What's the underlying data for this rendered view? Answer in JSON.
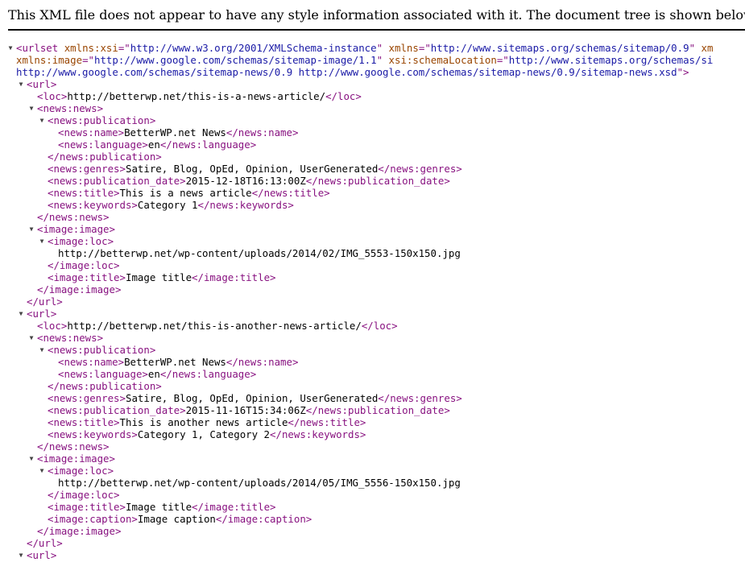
{
  "banner": {
    "message": "This XML file does not appear to have any style information associated with it. The document tree is shown below."
  },
  "colors": {
    "tag": "#881280",
    "attribute_name": "#994500",
    "attribute_value": "#1a1aa6",
    "text": "#000000"
  },
  "icons": {
    "collapse": "down-triangle-icon"
  },
  "lines": [
    [
      [
        "t",
        "<urlset"
      ],
      [
        "s",
        " "
      ],
      [
        "a",
        "xmlns:xsi"
      ],
      [
        "t",
        "=\""
      ],
      [
        "v",
        "http://www.w3.org/2001/XMLSchema-instance"
      ],
      [
        "t",
        "\""
      ],
      [
        "s",
        " "
      ],
      [
        "a",
        "xmlns"
      ],
      [
        "t",
        "=\""
      ],
      [
        "v",
        "http://www.sitemaps.org/schemas/sitemap/0.9"
      ],
      [
        "t",
        "\""
      ],
      [
        "s",
        " "
      ],
      [
        "a",
        "xm"
      ]
    ],
    [
      [
        "a",
        "xmlns:image"
      ],
      [
        "t",
        "=\""
      ],
      [
        "v",
        "http://www.google.com/schemas/sitemap-image/1.1"
      ],
      [
        "t",
        "\""
      ],
      [
        "s",
        " "
      ],
      [
        "a",
        "xsi:schemaLocation"
      ],
      [
        "t",
        "=\""
      ],
      [
        "v",
        "http://www.sitemaps.org/schemas/si"
      ]
    ],
    [
      [
        "v",
        "http://www.google.com/schemas/sitemap-news/0.9 http://www.google.com/schemas/sitemap-news/0.9/sitemap-news.xsd"
      ],
      [
        "t",
        "\">"
      ]
    ],
    [
      [
        "t",
        "<url>"
      ]
    ],
    [
      [
        "t",
        "<loc>"
      ],
      [
        "x",
        "http://betterwp.net/this-is-a-news-article/"
      ],
      [
        "t",
        "</loc>"
      ]
    ],
    [
      [
        "t",
        "<news:news>"
      ]
    ],
    [
      [
        "t",
        "<news:publication>"
      ]
    ],
    [
      [
        "t",
        "<news:name>"
      ],
      [
        "x",
        "BetterWP.net News"
      ],
      [
        "t",
        "</news:name>"
      ]
    ],
    [
      [
        "t",
        "<news:language>"
      ],
      [
        "x",
        "en"
      ],
      [
        "t",
        "</news:language>"
      ]
    ],
    [
      [
        "t",
        "</news:publication>"
      ]
    ],
    [
      [
        "t",
        "<news:genres>"
      ],
      [
        "x",
        "Satire, Blog, OpEd, Opinion, UserGenerated"
      ],
      [
        "t",
        "</news:genres>"
      ]
    ],
    [
      [
        "t",
        "<news:publication_date>"
      ],
      [
        "x",
        "2015-12-18T16:13:00Z"
      ],
      [
        "t",
        "</news:publication_date>"
      ]
    ],
    [
      [
        "t",
        "<news:title>"
      ],
      [
        "x",
        "This is a news article"
      ],
      [
        "t",
        "</news:title>"
      ]
    ],
    [
      [
        "t",
        "<news:keywords>"
      ],
      [
        "x",
        "Category 1"
      ],
      [
        "t",
        "</news:keywords>"
      ]
    ],
    [
      [
        "t",
        "</news:news>"
      ]
    ],
    [
      [
        "t",
        "<image:image>"
      ]
    ],
    [
      [
        "t",
        "<image:loc>"
      ]
    ],
    [
      [
        "x",
        "http://betterwp.net/wp-content/uploads/2014/02/IMG_5553-150x150.jpg"
      ]
    ],
    [
      [
        "t",
        "</image:loc>"
      ]
    ],
    [
      [
        "t",
        "<image:title>"
      ],
      [
        "x",
        "Image title"
      ],
      [
        "t",
        "</image:title>"
      ]
    ],
    [
      [
        "t",
        "</image:image>"
      ]
    ],
    [
      [
        "t",
        "</url>"
      ]
    ],
    [
      [
        "t",
        "<url>"
      ]
    ],
    [
      [
        "t",
        "<loc>"
      ],
      [
        "x",
        "http://betterwp.net/this-is-another-news-article/"
      ],
      [
        "t",
        "</loc>"
      ]
    ],
    [
      [
        "t",
        "<news:news>"
      ]
    ],
    [
      [
        "t",
        "<news:publication>"
      ]
    ],
    [
      [
        "t",
        "<news:name>"
      ],
      [
        "x",
        "BetterWP.net News"
      ],
      [
        "t",
        "</news:name>"
      ]
    ],
    [
      [
        "t",
        "<news:language>"
      ],
      [
        "x",
        "en"
      ],
      [
        "t",
        "</news:language>"
      ]
    ],
    [
      [
        "t",
        "</news:publication>"
      ]
    ],
    [
      [
        "t",
        "<news:genres>"
      ],
      [
        "x",
        "Satire, Blog, OpEd, Opinion, UserGenerated"
      ],
      [
        "t",
        "</news:genres>"
      ]
    ],
    [
      [
        "t",
        "<news:publication_date>"
      ],
      [
        "x",
        "2015-11-16T15:34:06Z"
      ],
      [
        "t",
        "</news:publication_date>"
      ]
    ],
    [
      [
        "t",
        "<news:title>"
      ],
      [
        "x",
        "This is another news article"
      ],
      [
        "t",
        "</news:title>"
      ]
    ],
    [
      [
        "t",
        "<news:keywords>"
      ],
      [
        "x",
        "Category 1, Category 2"
      ],
      [
        "t",
        "</news:keywords>"
      ]
    ],
    [
      [
        "t",
        "</news:news>"
      ]
    ],
    [
      [
        "t",
        "<image:image>"
      ]
    ],
    [
      [
        "t",
        "<image:loc>"
      ]
    ],
    [
      [
        "x",
        "http://betterwp.net/wp-content/uploads/2014/05/IMG_5556-150x150.jpg"
      ]
    ],
    [
      [
        "t",
        "</image:loc>"
      ]
    ],
    [
      [
        "t",
        "<image:title>"
      ],
      [
        "x",
        "Image title"
      ],
      [
        "t",
        "</image:title>"
      ]
    ],
    [
      [
        "t",
        "<image:caption>"
      ],
      [
        "x",
        "Image caption"
      ],
      [
        "t",
        "</image:caption>"
      ]
    ],
    [
      [
        "t",
        "</image:image>"
      ]
    ],
    [
      [
        "t",
        "</url>"
      ]
    ],
    [
      [
        "t",
        "<url>"
      ]
    ]
  ]
}
